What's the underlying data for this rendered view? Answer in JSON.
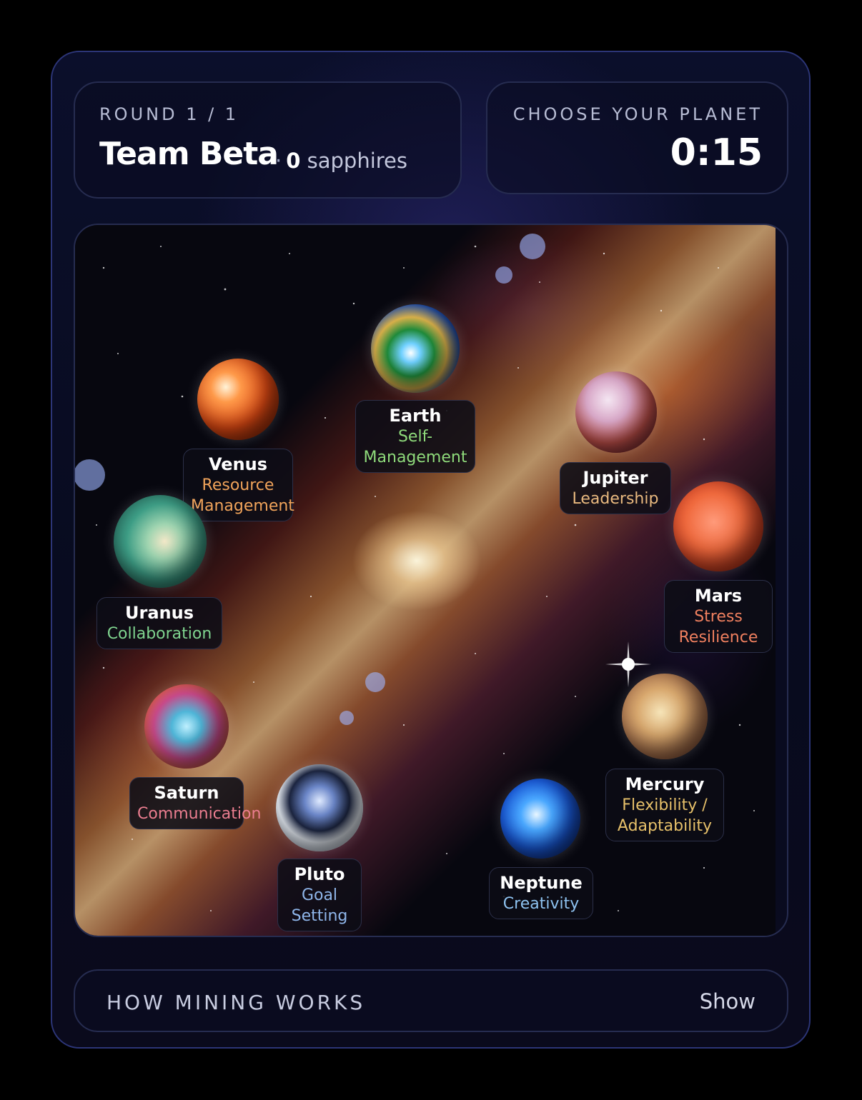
{
  "header": {
    "round_label": "ROUND 1 / 1",
    "team_name": "Team Beta",
    "separator": "·",
    "sapphires_count": "0",
    "sapphires_unit": "sapphires"
  },
  "timer": {
    "label": "CHOOSE YOUR PLANET",
    "value": "0:15"
  },
  "planets": [
    {
      "name": "Earth",
      "skill": "Self-\nManagement",
      "skill_color": "#8fdb7b",
      "icon": "earth-planet"
    },
    {
      "name": "Venus",
      "skill": "Resource\nManagement",
      "skill_color": "#f0a35a",
      "icon": "venus-planet"
    },
    {
      "name": "Jupiter",
      "skill": "Leadership",
      "skill_color": "#e9b97f",
      "icon": "jupiter-planet"
    },
    {
      "name": "Mars",
      "skill": "Stress\nResilience",
      "skill_color": "#f0805f",
      "icon": "mars-planet"
    },
    {
      "name": "Uranus",
      "skill": "Collaboration",
      "skill_color": "#7fd48f",
      "icon": "uranus-planet"
    },
    {
      "name": "Mercury",
      "skill": "Flexibility /\nAdaptability",
      "skill_color": "#e6c06a",
      "icon": "mercury-planet"
    },
    {
      "name": "Saturn",
      "skill": "Communication",
      "skill_color": "#ea7d8f",
      "icon": "saturn-planet"
    },
    {
      "name": "Pluto",
      "skill": "Goal\nSetting",
      "skill_color": "#8fb6ea",
      "icon": "pluto-planet"
    },
    {
      "name": "Neptune",
      "skill": "Creativity",
      "skill_color": "#8ec2f0",
      "icon": "neptune-planet"
    }
  ],
  "mining": {
    "label": "HOW MINING WORKS",
    "toggle_label": "Show"
  }
}
